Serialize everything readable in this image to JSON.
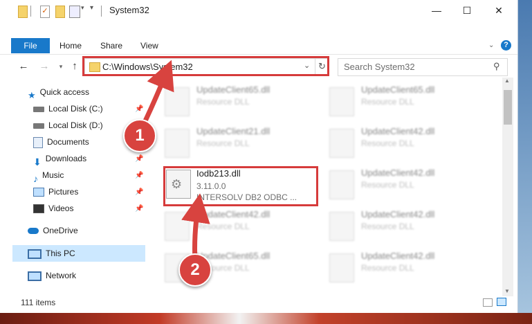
{
  "window": {
    "title": "System32",
    "minimize": "—",
    "maximize": "☐",
    "close": "✕"
  },
  "ribbon": {
    "file": "File",
    "home": "Home",
    "share": "Share",
    "view": "View",
    "help": "?"
  },
  "address": {
    "path": "C:\\Windows\\System32",
    "search_placeholder": "Search System32"
  },
  "sidebar": {
    "items": [
      {
        "label": "Quick access"
      },
      {
        "label": "Local Disk (C:)"
      },
      {
        "label": "Local Disk (D:)"
      },
      {
        "label": "Documents"
      },
      {
        "label": "Downloads"
      },
      {
        "label": "Music"
      },
      {
        "label": "Pictures"
      },
      {
        "label": "Videos"
      },
      {
        "label": "OneDrive"
      },
      {
        "label": "This PC"
      },
      {
        "label": "Network"
      }
    ]
  },
  "files": {
    "highlighted": {
      "name": "Iodb213.dll",
      "version": "3.11.0.0",
      "desc": "INTERSOLV DB2 ODBC ..."
    },
    "blurred": [
      {
        "name": "UpdateClient65.dll",
        "desc": "Resource DLL"
      },
      {
        "name": "UpdateClient65.dll",
        "desc": "Resource DLL"
      },
      {
        "name": "UpdateClient21.dll",
        "desc": "Resource DLL"
      },
      {
        "name": "UpdateClient42.dll",
        "desc": "Resource DLL"
      },
      {
        "name": "UpdateClient42.dll",
        "desc": "Resource DLL"
      },
      {
        "name": "UpdateClient42.dll",
        "desc": "Resource DLL"
      },
      {
        "name": "UpdateClient42.dll",
        "desc": "Resource DLL"
      },
      {
        "name": "UpdateClient65.dll",
        "desc": "Resource DLL"
      },
      {
        "name": "UpdateClient42.dll",
        "desc": "Resource DLL"
      }
    ]
  },
  "status": {
    "count": "111 items"
  },
  "annotations": {
    "step1": "1",
    "step2": "2"
  },
  "colors": {
    "accent": "#1979ca",
    "highlight": "#d63b3b",
    "selected": "#cce8ff"
  }
}
